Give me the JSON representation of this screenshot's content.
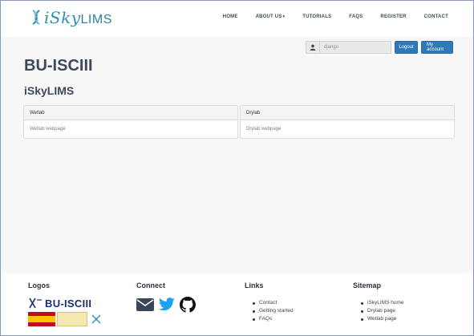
{
  "brand": {
    "name_prefix": "iSky",
    "name_suffix": "LIMS"
  },
  "nav": {
    "items": [
      {
        "label": "HOME"
      },
      {
        "label": "ABOUT US"
      },
      {
        "label": "TUTORIALS"
      },
      {
        "label": "FAQS"
      },
      {
        "label": "REGISTER"
      },
      {
        "label": "CONTACT"
      }
    ],
    "about_caret": "▾"
  },
  "user": {
    "username": "django",
    "logout_label": "Logout",
    "account_label": "My account"
  },
  "main": {
    "title": "BU-ISCIII",
    "subtitle": "iSkyLIMS",
    "panels": [
      {
        "heading": "Wetlab",
        "link": "Wetlab webpage"
      },
      {
        "heading": "Drylab",
        "link": "Drylab webpage"
      }
    ]
  },
  "footer": {
    "logos_heading": "Logos",
    "logo_text": "BU-ISCIII",
    "connect_heading": "Connect",
    "links_heading": "Links",
    "links": [
      "Contact",
      "Getting started",
      "FAQs"
    ],
    "sitemap_heading": "Sitemap",
    "sitemap": [
      "iSkyLIMS home",
      "Drylab page",
      "Wetlab page"
    ]
  },
  "colors": {
    "accent": "#2e79b9",
    "heading": "#40495a",
    "brand": "#2f8fb3"
  }
}
